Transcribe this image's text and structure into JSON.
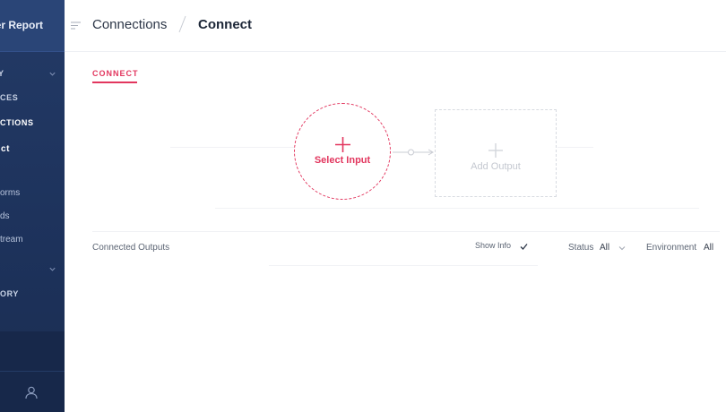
{
  "sidebar": {
    "brand": "er Report",
    "section_primary": "Y",
    "items": [
      "CES",
      "CTIONS",
      "ct"
    ],
    "sub_items": [
      "orms",
      "ds",
      "tream"
    ],
    "section_secondary": "ORY"
  },
  "breadcrumb": {
    "parent": "Connections",
    "current": "Connect"
  },
  "tab": {
    "label": "CONNECT"
  },
  "flow": {
    "input_label": "Select Input",
    "output_label": "Add Output"
  },
  "outputs": {
    "title": "Connected Outputs",
    "show_info_label": "Show Info",
    "status_label": "Status",
    "status_value": "All",
    "environment_label": "Environment",
    "environment_value": "All"
  },
  "colors": {
    "accent": "#e2365e",
    "sidebar": "#1d325b"
  },
  "icons": [
    "menu-icon",
    "plus-icon",
    "check-icon",
    "chevron-down-icon",
    "user-icon"
  ]
}
